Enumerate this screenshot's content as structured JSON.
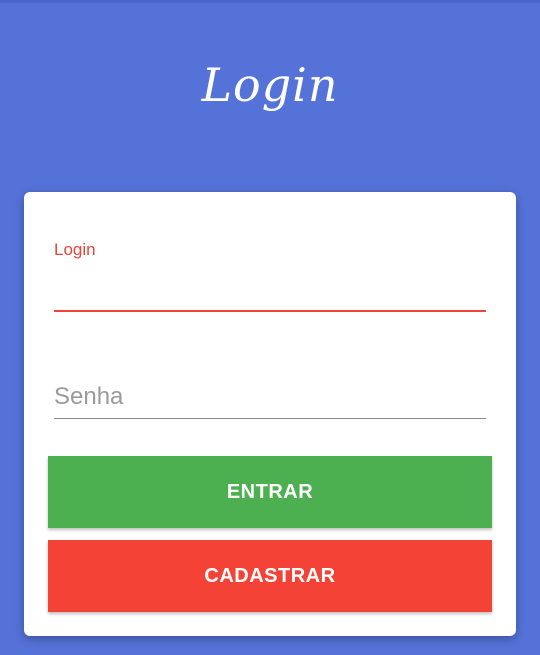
{
  "header": {
    "title": "Login"
  },
  "form": {
    "login_label": "Login",
    "login_value": "",
    "senha_placeholder": "Senha",
    "senha_value": ""
  },
  "buttons": {
    "entrar_label": "ENTRAR",
    "cadastrar_label": "CADASTRAR"
  },
  "colors": {
    "background": "#5472d8",
    "active_field": "#f04438",
    "entrar": "#4caf50",
    "cadastrar": "#f44336"
  }
}
